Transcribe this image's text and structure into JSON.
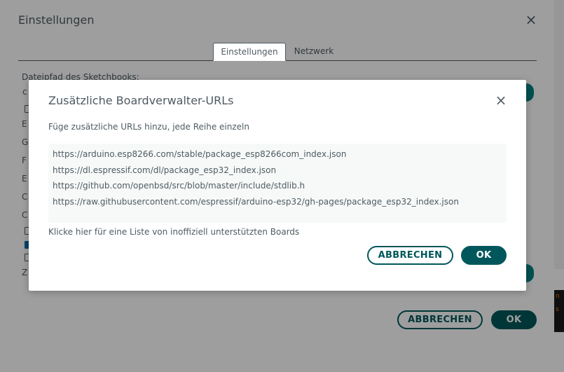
{
  "settings": {
    "title": "Einstellungen",
    "close_symbol": "×",
    "tabs": [
      {
        "label": "Einstellungen",
        "active": true
      },
      {
        "label": "Netzwerk",
        "active": false
      }
    ],
    "sketchbook_label": "Dateipfad des Sketchbooks:",
    "row_letters": [
      "E",
      "G",
      "F",
      "E",
      "C",
      "C",
      "Z"
    ],
    "checkboxes": [
      false,
      false,
      true,
      false
    ],
    "cancel_label": "ABBRECHEN",
    "ok_label": "OK"
  },
  "side_fragment": {
    "lines": [
      "n",
      "s"
    ]
  },
  "modal": {
    "title": "Zusätzliche Boardverwalter-URLs",
    "close_symbol": "×",
    "description": "Füge zusätzliche URLs hinzu, jede Reihe einzeln",
    "urls": [
      "https://arduino.esp8266.com/stable/package_esp8266com_index.json",
      "https://dl.espressif.com/dl/package_esp32_index.json",
      "https://github.com/openbsd/src/blob/master/include/stdlib.h",
      "https://raw.githubusercontent.com/espressif/arduino-esp32/gh-pages/package_esp32_index.json"
    ],
    "unofficial_link": "Klicke hier für eine Liste von inoffiziell unterstützten Boards",
    "cancel_label": "ABBRECHEN",
    "ok_label": "OK"
  },
  "colors": {
    "accent_teal": "#008184",
    "button_dark_teal": "#00575b",
    "text_gray": "#4e5b61",
    "checkbox_blue": "#0a6ba8"
  },
  "icons": {
    "close": "close-icon",
    "checkbox": "checkbox-icon"
  }
}
